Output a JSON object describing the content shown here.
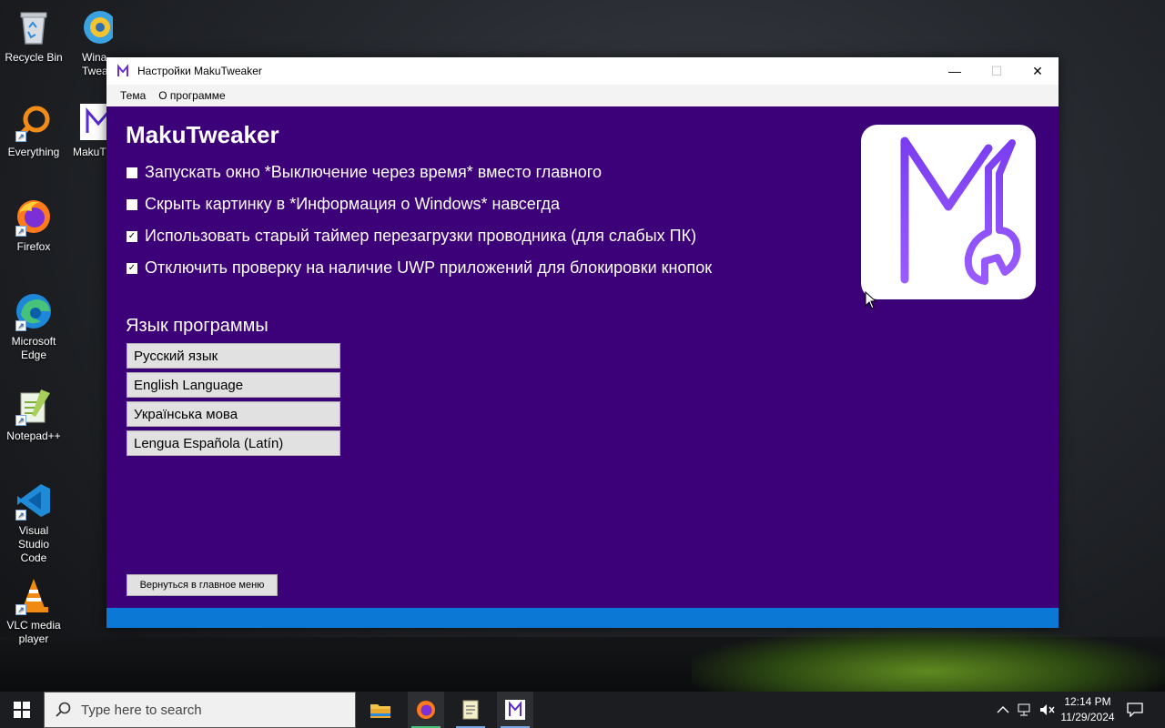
{
  "desktop": {
    "icons": [
      {
        "label": "Recycle Bin",
        "icon": "recycle-bin-icon"
      },
      {
        "label": "Everything",
        "icon": "everything-search-icon"
      },
      {
        "label": "Firefox",
        "icon": "firefox-icon"
      },
      {
        "label": "Microsoft Edge",
        "icon": "edge-icon"
      },
      {
        "label": "Notepad++",
        "icon": "notepad-plus-plus-icon"
      },
      {
        "label": "Visual Studio Code",
        "icon": "vscode-icon"
      },
      {
        "label": "VLC media player",
        "icon": "vlc-icon"
      }
    ],
    "partial_icons": [
      {
        "label": "Wina Twea",
        "icon": "winaero-tweaker-icon"
      },
      {
        "label": "MakuT",
        "icon": "makutweaker-icon"
      }
    ]
  },
  "window": {
    "title": "Настройки MakuTweaker",
    "controls": {
      "minimize": "—",
      "maximize": "☐",
      "close": "✕"
    },
    "menu": [
      "Тема",
      "О программе"
    ],
    "app_title": "MakuTweaker",
    "options": [
      {
        "label": "Запускать окно *Выключение через время* вместо главного",
        "checked": false
      },
      {
        "label": "Скрыть картинку в *Информация о Windows* навсегда",
        "checked": false
      },
      {
        "label": "Использовать старый таймер перезагрузки проводника (для слабых ПК)",
        "checked": true
      },
      {
        "label": "Отключить проверку на наличие UWP приложений для блокировки кнопок",
        "checked": true
      }
    ],
    "language_title": "Язык программы",
    "languages": [
      "Русский язык",
      "English Language",
      "Українська мова",
      "Lengua Española (Latín)"
    ],
    "back_button": "Вернуться в главное меню",
    "colors": {
      "background": "#3c0078",
      "statusbar": "#0a78d4",
      "logo_stroke": "#8a3cf0"
    }
  },
  "taskbar": {
    "search_placeholder": "Type here to search",
    "apps": [
      "file-explorer-icon",
      "firefox-icon",
      "notepad-icon",
      "makutweaker-icon"
    ],
    "clock_time": "12:14 PM",
    "clock_date": "11/29/2024"
  }
}
